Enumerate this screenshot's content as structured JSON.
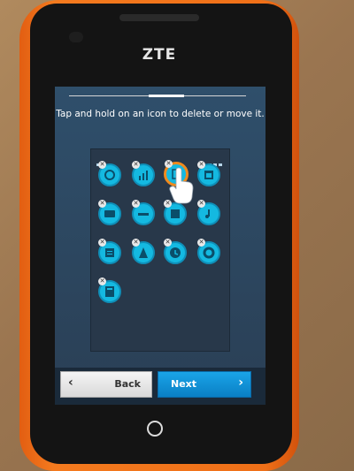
{
  "device": {
    "brand": "ZTE"
  },
  "setup": {
    "progress_fraction": 0.2,
    "instruction": "Tap and hold on an icon to delete or move it."
  },
  "navigation": {
    "back_label": "Back",
    "next_label": "Next"
  },
  "colors": {
    "phone_body": "#f47a1e",
    "screen_bg": "#2f4f6b",
    "app_icon": "#14b9e1",
    "next_button": "#0a7fc4",
    "selection_ring": "#f08a1e"
  },
  "grid_icons": [
    "clock-icon",
    "chart-icon",
    "selected-app-icon",
    "calendar-icon",
    "video-icon",
    "dialer-icon",
    "music-icon",
    "music-note-icon",
    "notes-icon",
    "fm-icon",
    "time-icon",
    "settings-icon",
    "calculator-icon"
  ],
  "dock_icons": [
    "phone-icon",
    "messages-icon",
    "contacts-icon",
    "chat-icon"
  ]
}
